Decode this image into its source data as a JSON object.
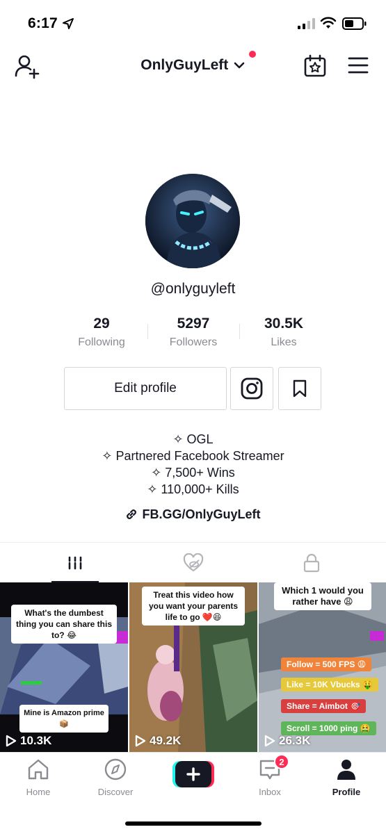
{
  "status_bar": {
    "time": "6:17"
  },
  "header": {
    "username": "OnlyGuyLeft"
  },
  "profile": {
    "handle": "@onlyguyleft",
    "stats": [
      {
        "value": "29",
        "label": "Following"
      },
      {
        "value": "5297",
        "label": "Followers"
      },
      {
        "value": "30.5K",
        "label": "Likes"
      }
    ],
    "edit_label": "Edit profile",
    "bio_lines": [
      "✧ OGL",
      "✧ Partnered Facebook Streamer",
      "✧ 7,500+ Wins",
      "✧ 110,000+ Kills"
    ],
    "link": "FB.GG/OnlyGuyLeft"
  },
  "videos": [
    {
      "caption": "What's the dumbest thing you can share this to? 😂",
      "sub_caption": "Mine is Amazon prime 📦",
      "views": "10.3K"
    },
    {
      "caption": "Treat this video how you want your parents life to go ❤️😆",
      "views": "49.2K"
    },
    {
      "caption": "Which 1 would you rather have 😩",
      "options": [
        "Follow = 500 FPS 😩",
        "Like = 10K Vbucks 🤑",
        "Share = Aimbot 🎯",
        "Scroll = 1000 ping 🤮"
      ],
      "views": "26.3K"
    }
  ],
  "bottom_nav": {
    "items": [
      "Home",
      "Discover",
      "Inbox",
      "Profile"
    ],
    "inbox_badge": "2"
  },
  "colors": {
    "accent": "#fe2c55",
    "text": "#161823",
    "muted": "#8a8b91",
    "border": "#d6d6d8"
  }
}
